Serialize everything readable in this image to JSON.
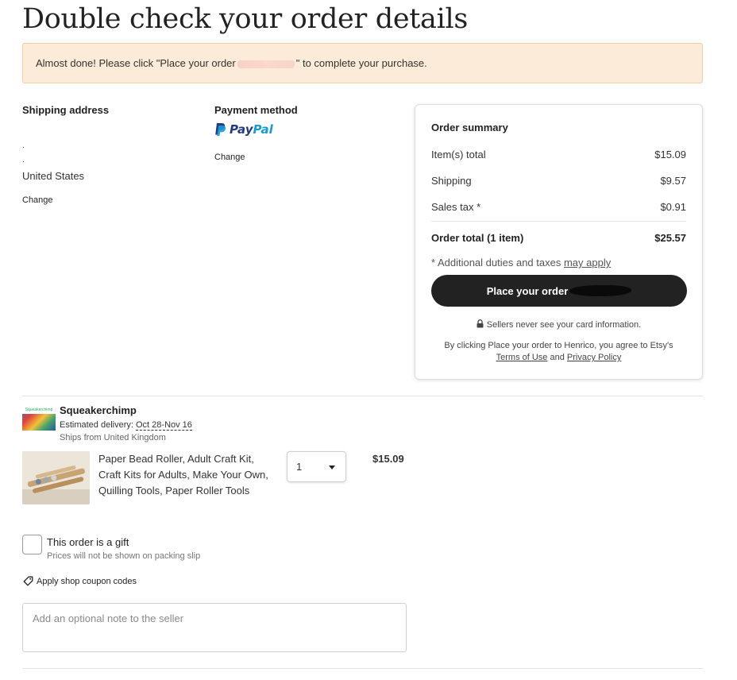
{
  "page": {
    "title": "Double check your order details"
  },
  "banner": {
    "text_before": "Almost done! Please click \"Place your order",
    "text_after": "\" to complete your purchase."
  },
  "shipping": {
    "label": "Shipping address",
    "line1": ".",
    "line2": ".",
    "country": "United States",
    "change": "Change"
  },
  "payment": {
    "label": "Payment method",
    "logo_pay": "Pay",
    "logo_pal": "Pal",
    "change": "Change"
  },
  "summary": {
    "title": "Order summary",
    "items_label": "Item(s) total",
    "items_value": "$15.09",
    "shipping_label": "Shipping",
    "shipping_value": "$9.57",
    "tax_label": "Sales tax *",
    "tax_value": "$0.91",
    "total_label": "Order total (1 item)",
    "total_value": "$25.57",
    "duties_text": "* Additional duties and taxes ",
    "duties_link": "may apply",
    "place_order": "Place your order",
    "secure_text": "Sellers never see your card information.",
    "legal_text": "By clicking Place your order to Henrico, you agree to Etsy's",
    "terms": "Terms of Use",
    "and": "and",
    "privacy": "Privacy Policy"
  },
  "shop": {
    "thumb_text": "Squeakerchimp",
    "name": "Squeakerchimp",
    "est_label": "Estimated delivery:",
    "est_date": "Oct 28-Nov 16",
    "ships_from": "Ships from United Kingdom"
  },
  "item": {
    "title": "Paper Bead Roller, Adult Craft Kit, Craft Kits for Adults, Make Your Own, Quilling Tools, Paper Roller Tools",
    "qty": "1",
    "price": "$15.09"
  },
  "gift": {
    "label": "This order is a gift",
    "sub": "Prices will not be shown on packing slip"
  },
  "coupon": {
    "label": "Apply shop coupon codes"
  },
  "note": {
    "placeholder": "Add an optional note to the seller"
  }
}
